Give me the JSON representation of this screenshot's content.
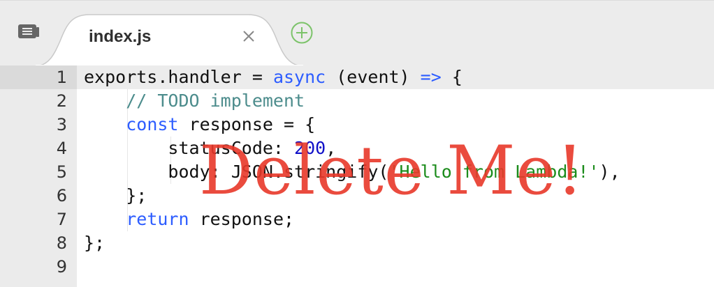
{
  "tab": {
    "label": "index.js"
  },
  "icons": {
    "menu": "menu-icon",
    "close": "close-icon",
    "add": "add-tab-icon"
  },
  "colors": {
    "keyword": "#2d5dff",
    "comment": "#4c8c8c",
    "number": "#1010c8",
    "string": "#1c8c1c",
    "overlay": "#e8382a",
    "add_icon": "#7cc36a"
  },
  "editor": {
    "line_numbers": [
      "1",
      "2",
      "3",
      "4",
      "5",
      "6",
      "7",
      "8",
      "9"
    ],
    "lines": [
      [
        {
          "t": "exports.handler = ",
          "c": ""
        },
        {
          "t": "async",
          "c": "kw"
        },
        {
          "t": " (event) ",
          "c": ""
        },
        {
          "t": "=>",
          "c": "kw"
        },
        {
          "t": " {",
          "c": ""
        }
      ],
      [
        {
          "t": "    ",
          "c": ""
        },
        {
          "t": "// TODO implement",
          "c": "cm"
        }
      ],
      [
        {
          "t": "    ",
          "c": ""
        },
        {
          "t": "const",
          "c": "kw"
        },
        {
          "t": " response = {",
          "c": ""
        }
      ],
      [
        {
          "t": "        statusCode: ",
          "c": ""
        },
        {
          "t": "200",
          "c": "num"
        },
        {
          "t": ",",
          "c": ""
        }
      ],
      [
        {
          "t": "        body: JSON.stringify(",
          "c": ""
        },
        {
          "t": "'Hello from Lambda!'",
          "c": "str"
        },
        {
          "t": "),",
          "c": ""
        }
      ],
      [
        {
          "t": "    };",
          "c": ""
        }
      ],
      [
        {
          "t": "    ",
          "c": ""
        },
        {
          "t": "return",
          "c": "kw"
        },
        {
          "t": " response;",
          "c": ""
        }
      ],
      [
        {
          "t": "};",
          "c": ""
        }
      ],
      []
    ]
  },
  "overlay": {
    "text": "Delete Me!"
  }
}
